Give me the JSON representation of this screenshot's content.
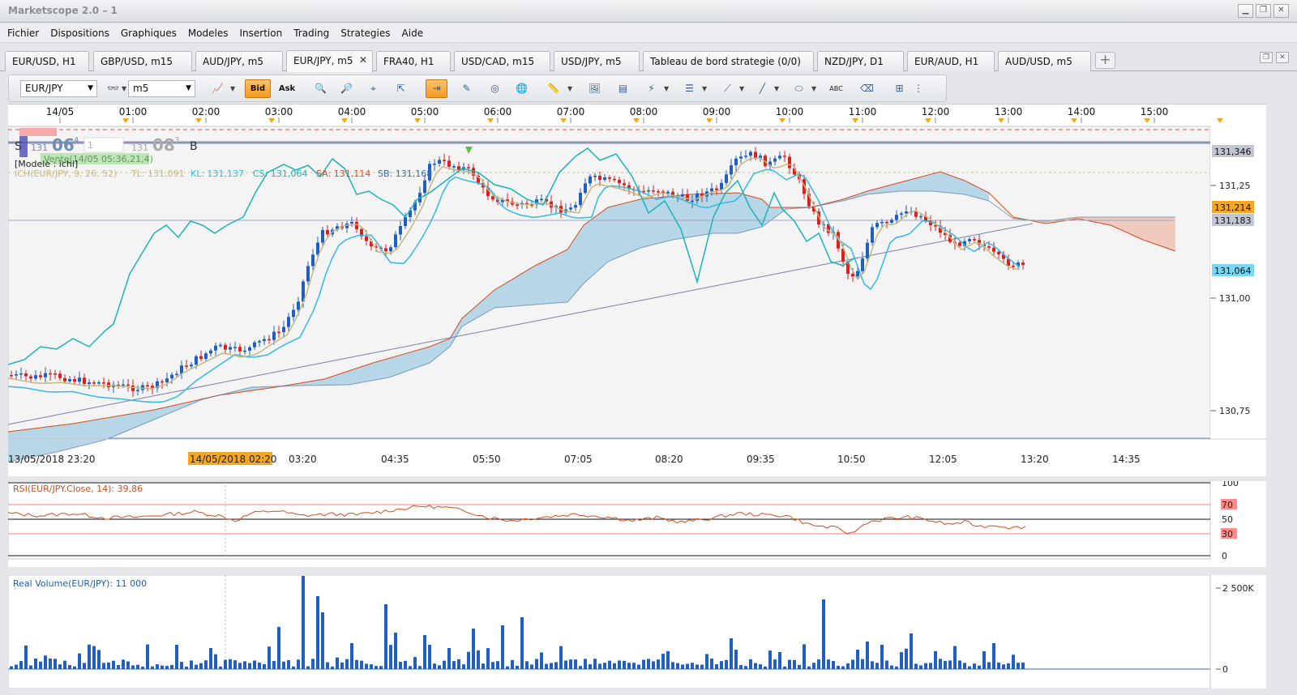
{
  "window": {
    "title": "Marketscope 2.0 – 1"
  },
  "menu": [
    "Fichier",
    "Dispositions",
    "Graphiques",
    "Modeles",
    "Insertion",
    "Trading",
    "Strategies",
    "Aide"
  ],
  "tabs": [
    {
      "label": "EUR/USD, H1"
    },
    {
      "label": "GBP/USD, m15"
    },
    {
      "label": "AUD/JPY, m5"
    },
    {
      "label": "EUR/JPY, m5",
      "active": true
    },
    {
      "label": "FRA40, H1"
    },
    {
      "label": "USD/CAD, m15"
    },
    {
      "label": "USD/JPY, m5"
    },
    {
      "label": "Tableau de bord strategie (0/0)"
    },
    {
      "label": "NZD/JPY, D1"
    },
    {
      "label": "EUR/AUD, H1"
    },
    {
      "label": "AUD/USD, m5"
    }
  ],
  "toolbar": {
    "symbol": "EUR/JPY",
    "timeframe": "m5",
    "bid": "Bid",
    "ask": "Ask"
  },
  "chart": {
    "top_time_labels": [
      "14/05",
      "01:00",
      "02:00",
      "03:00",
      "04:00",
      "05:00",
      "06:00",
      "07:00",
      "08:00",
      "09:00",
      "10:00",
      "11:00",
      "12:00",
      "13:00",
      "14:00",
      "15:00"
    ],
    "bottom_time_labels": [
      "13/05/2018 23:20",
      "14/05/2018 02:20",
      "03:20",
      "04:35",
      "05:50",
      "07:05",
      "08:20",
      "09:35",
      "10:50",
      "12:05",
      "13:20",
      "14:35"
    ],
    "price_labels": [
      "131,25",
      "131,00",
      "130,75"
    ],
    "price_markers": [
      {
        "label": "131,346",
        "color": "#b9bdc9"
      },
      {
        "label": "131,214",
        "color": "#f5a623"
      },
      {
        "label": "131,183",
        "color": "#b9bdc9"
      },
      {
        "label": "131,064",
        "color": "#66d4f5"
      }
    ],
    "sell": {
      "tag": "S",
      "big": "131",
      "pips": "06",
      "sup": "4"
    },
    "buy": {
      "tag": "B",
      "big": "131",
      "pips": "08",
      "sup": "3"
    },
    "spread": "1",
    "tooltip": "Vente(14/05 05:36,21,4)",
    "model_label": "[Modele : ichi]",
    "ichimoku": {
      "name": "ICH(EUR/JPY, 9, 26, 52)",
      "tl": "TL: 131,091",
      "kl": "KL: 131,137",
      "cs": "CS: 131,064",
      "sa": "SA: 131,114",
      "sb": "SB: 131,168"
    },
    "colors": {
      "bull": "#1f5fc2",
      "bear": "#dd1f1f",
      "tenkan": "#c5b880",
      "kijun": "#35b9e6",
      "chikou": "#1cb3b8",
      "cloud_bull": "#b3d4e6",
      "cloud_bear": "#f0c7bb",
      "span_a": "#d84a1c",
      "span_b": "#3a6fa0"
    }
  },
  "rsi": {
    "label": "RSI(EUR/JPY.Close, 14): 39,86",
    "scale": [
      "100",
      "70",
      "50",
      "30",
      "0"
    ]
  },
  "volume": {
    "label": "Real Volume(EUR/JPY): 11 000",
    "scale": [
      "2 500K",
      "0"
    ]
  }
}
